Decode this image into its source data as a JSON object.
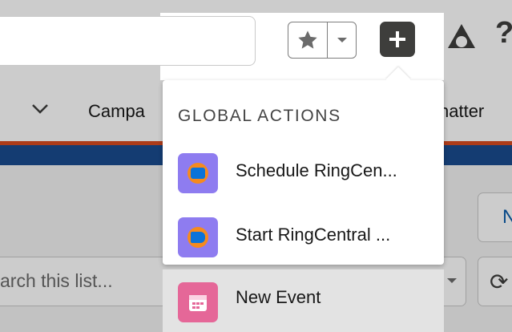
{
  "header": {
    "favorites_icon": "star-icon",
    "favorites_menu_icon": "chevron-down-icon",
    "global_actions_icon": "plus-icon",
    "setup_icon": "setup-icon",
    "help_icon_glyph": "?"
  },
  "nav": {
    "partial_tab_left": "Campa",
    "partial_tab_right": "hatter"
  },
  "list": {
    "new_button_partial": "N",
    "search_placeholder": "arch this list...",
    "refresh_glyph": "⟳"
  },
  "global_actions": {
    "title": "GLOBAL ACTIONS",
    "items": [
      {
        "label": "Schedule RingCen...",
        "icon": "ringcentral-schedule-icon",
        "color": "#8e7cf0"
      },
      {
        "label": "Start RingCentral ...",
        "icon": "ringcentral-video-icon",
        "color": "#8e7cf0"
      },
      {
        "label": "New Event",
        "icon": "calendar-icon",
        "color": "#e56798"
      }
    ]
  }
}
